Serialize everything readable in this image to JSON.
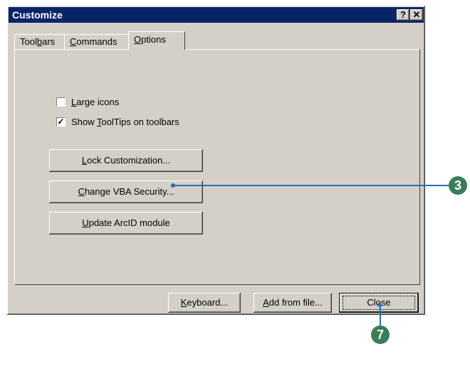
{
  "window": {
    "title": "Customize",
    "help_button": "?",
    "close_button": "✕"
  },
  "tabs": [
    {
      "pre": "Tool",
      "u": "b",
      "post": "ars"
    },
    {
      "pre": "",
      "u": "C",
      "post": "ommands"
    },
    {
      "pre": "",
      "u": "O",
      "post": "ptions"
    }
  ],
  "options": {
    "large_icons": {
      "pre": "",
      "u": "L",
      "post": "arge icons",
      "checked": false,
      "mark": ""
    },
    "show_tooltips": {
      "pre": "Show ",
      "u": "T",
      "post": "oolTips on toolbars",
      "checked": true,
      "mark": "✓"
    }
  },
  "buttons": {
    "lock": {
      "pre": "",
      "u": "L",
      "post": "ock Customization..."
    },
    "vba": {
      "pre": "",
      "u": "C",
      "post": "hange VBA Security..."
    },
    "arcid": {
      "pre": "",
      "u": "U",
      "post": "pdate ArcID module"
    },
    "keyboard": {
      "pre": "",
      "u": "K",
      "post": "eyboard..."
    },
    "add_from_file": {
      "pre": "",
      "u": "A",
      "post": "dd from file..."
    },
    "close": {
      "label": "Close"
    }
  },
  "callouts": {
    "step3": "3",
    "step7": "7",
    "color": "#3a7d57",
    "line_color": "#2a6db5"
  }
}
